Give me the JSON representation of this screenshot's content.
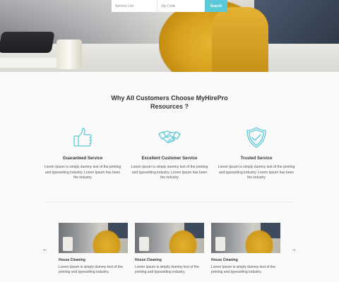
{
  "search": {
    "service_placeholder": "Service List",
    "zip_placeholder": "Zip Code",
    "button_label": "Search"
  },
  "why": {
    "title_line1": "Why All Customers Choose MyHirePro",
    "title_line2": "Resources ?",
    "features": [
      {
        "icon": "thumbs-up-icon",
        "title": "Guaranteed Service",
        "desc": "Lorem Ipsum is simply dummy text of the printing and typesetting industry. Lorem Ipsum has been the industry"
      },
      {
        "icon": "handshake-icon",
        "title": "Excellent Customer Service",
        "desc": "Lorem Ipsum is simply dummy text of the printing and typesetting industry. Lorem Ipsum has been the industry"
      },
      {
        "icon": "shield-check-icon",
        "title": "Trusted Service",
        "desc": "Lorem Ipsum is simply dummy text of the printing and typesetting industry. Lorem Ipsum has been the industry"
      }
    ]
  },
  "services": {
    "prev_icon": "arrow-left-icon",
    "next_icon": "arrow-right-icon",
    "prev_glyph": "←",
    "next_glyph": "→",
    "cards": [
      {
        "title": "House Cleaning",
        "desc": "Lorem Ipsum is simply dummy text of the printing and typesetting industry."
      },
      {
        "title": "House Cleaning",
        "desc": "Lorem Ipsum is simply dummy text of the printing and typesetting industry."
      },
      {
        "title": "House Cleaning",
        "desc": "Lorem Ipsum is simply dummy text of the printing and typesetting industry."
      }
    ]
  },
  "colors": {
    "accent": "#5cc9d8",
    "section_bg": "#fafafa"
  }
}
